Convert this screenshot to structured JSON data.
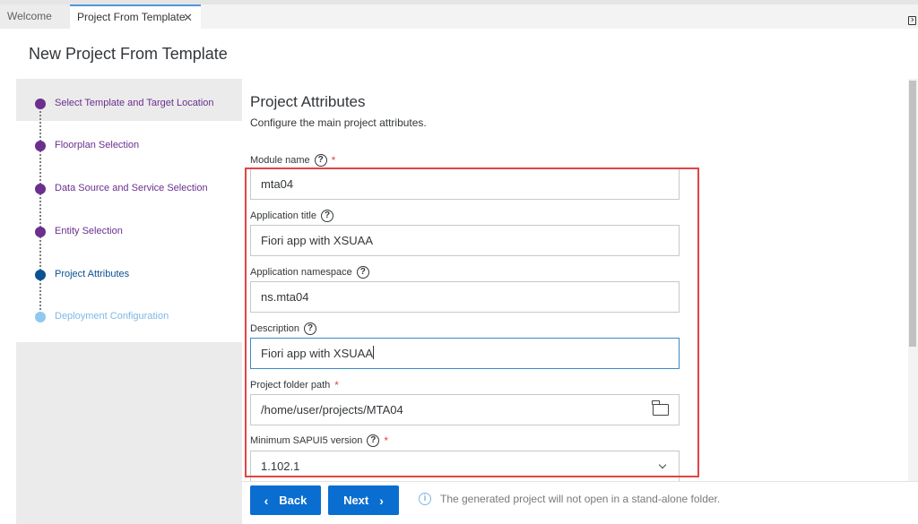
{
  "tabs": [
    {
      "label": "Welcome"
    },
    {
      "label": "Project From Template"
    }
  ],
  "page": {
    "title": "New Project From Template"
  },
  "steps": [
    {
      "label": "Select Template and Target Location",
      "state": "done"
    },
    {
      "label": "Floorplan Selection",
      "state": "done"
    },
    {
      "label": "Data Source and Service Selection",
      "state": "done"
    },
    {
      "label": "Entity Selection",
      "state": "done"
    },
    {
      "label": "Project Attributes",
      "state": "current"
    },
    {
      "label": "Deployment Configuration",
      "state": "pending"
    }
  ],
  "section": {
    "title": "Project Attributes",
    "description": "Configure the main project attributes."
  },
  "fields": {
    "module_name": {
      "label": "Module name",
      "value": "mta04",
      "required": true
    },
    "app_title": {
      "label": "Application title",
      "value": "Fiori app with XSUAA"
    },
    "app_namespace": {
      "label": "Application namespace",
      "value": "ns.mta04"
    },
    "description": {
      "label": "Description",
      "value": "Fiori app with XSUAA"
    },
    "folder_path": {
      "label": "Project folder path",
      "value": "/home/user/projects/MTA04",
      "required": true
    },
    "sapui5_version": {
      "label": "Minimum SAPUI5 version",
      "value": "1.102.1",
      "required": true
    }
  },
  "footer": {
    "back_label": "Back",
    "next_label": "Next",
    "info_text": "The generated project will not open in a stand-alone folder."
  },
  "glyphs": {
    "close": "✕",
    "help": "?",
    "required": "*",
    "back_arrow": "‹",
    "next_arrow": "›",
    "info": "i"
  },
  "colors": {
    "accent": "#0a6ed1",
    "step_done": "#6a2f8f",
    "step_current": "#0a5291",
    "step_pending": "#8fc9f0",
    "highlight": "#e04545"
  }
}
